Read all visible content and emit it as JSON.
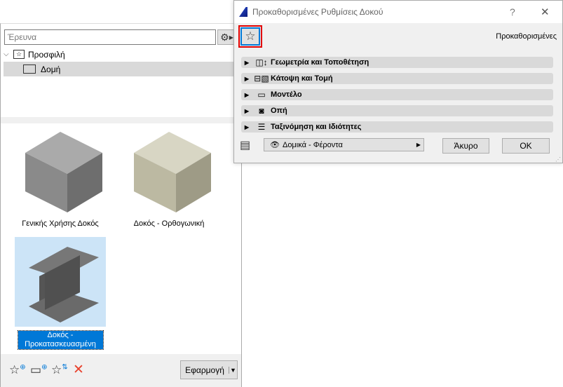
{
  "left_panel": {
    "search_placeholder": "Έρευνα",
    "tree": [
      {
        "label": "Προσφιλή",
        "icon": "star-folder-icon"
      },
      {
        "label": "Δομή",
        "icon": "folder-icon"
      }
    ],
    "items": [
      {
        "label": "Γενικής Χρήσης Δοκός",
        "selected": false
      },
      {
        "label": "Δοκός - Ορθογωνική",
        "selected": false
      },
      {
        "label": "Δοκός - Προκατασκευασμένη",
        "selected": true
      }
    ],
    "apply_label": "Εφαρμογή",
    "delete_color": "#e8412c"
  },
  "dialog": {
    "title": "Προκαθορισμένες Ρυθμίσεις Δοκού",
    "help": "?",
    "close": "✕",
    "preset_label": "Προκαθορισμένες",
    "sections": [
      {
        "label": "Γεωμετρία και Τοποθέτηση",
        "icon": "◫↕"
      },
      {
        "label": "Κάτοψη και Τομή",
        "icon": "⊟▧"
      },
      {
        "label": "Μοντέλο",
        "icon": "▭"
      },
      {
        "label": "Οπή",
        "icon": "◙"
      },
      {
        "label": "Ταξινόμηση και Ιδιότητες",
        "icon": "☰"
      }
    ],
    "layer": "Δομικά - Φέροντα",
    "cancel": "Άκυρο",
    "ok": "OK",
    "highlight_color": "#e00000"
  }
}
